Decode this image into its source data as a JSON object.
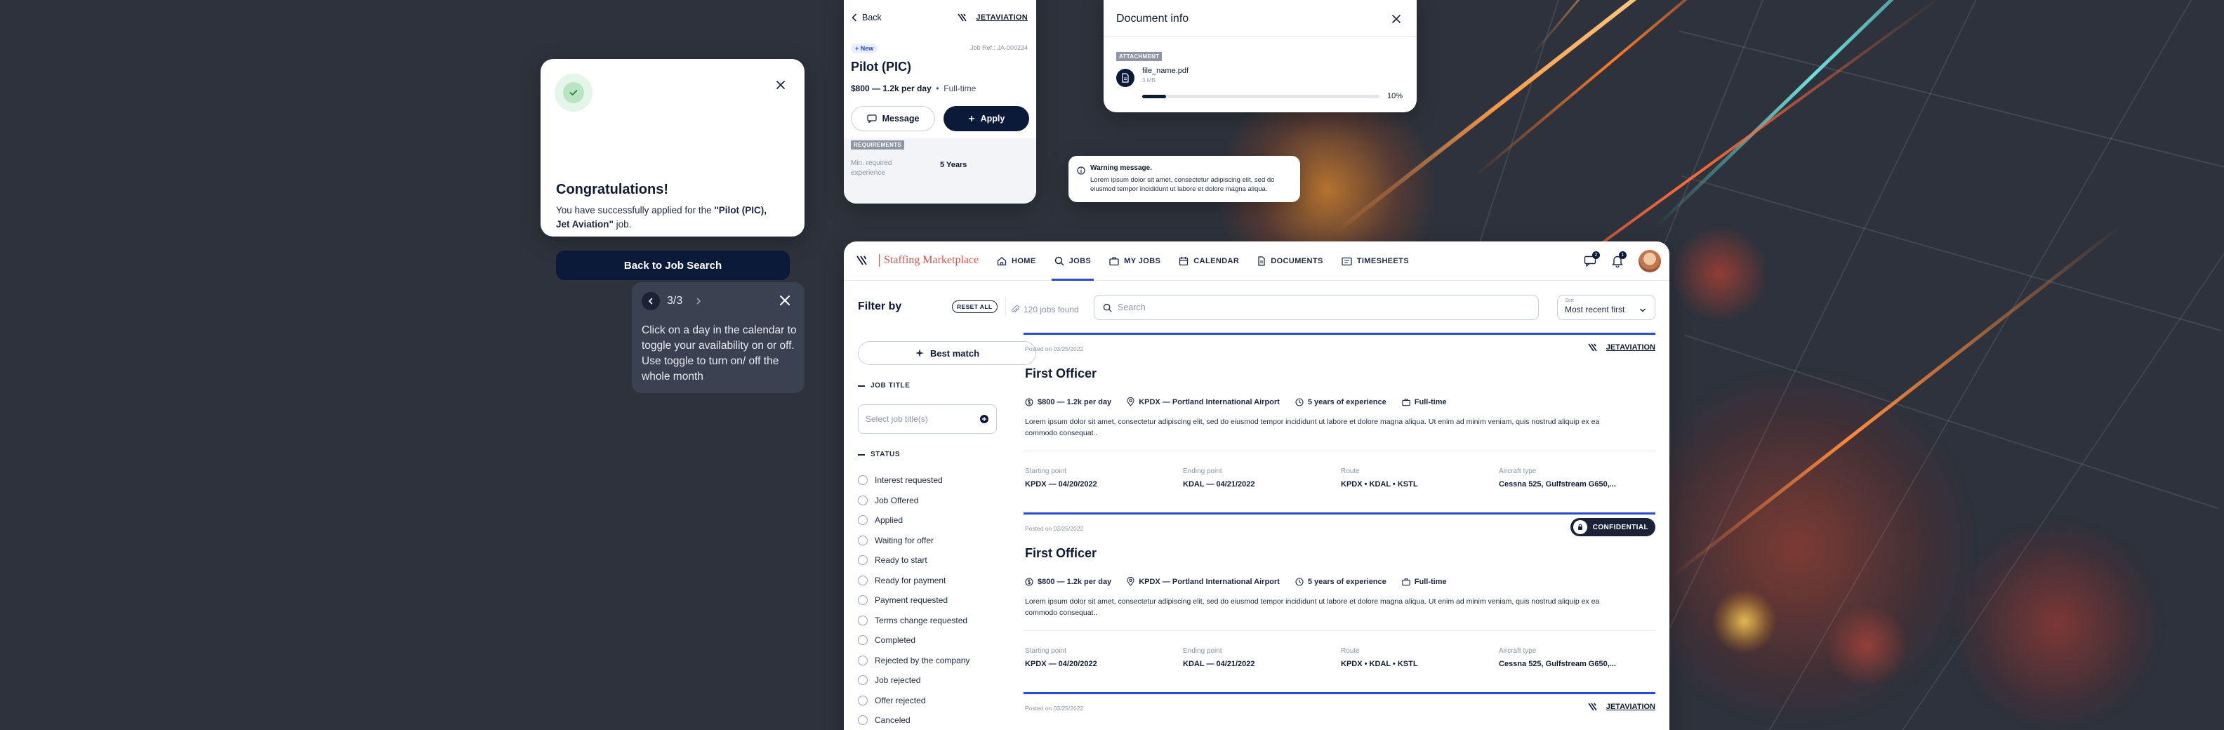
{
  "congrats": {
    "title": "Congratulations!",
    "message_prefix": "You have successfully applied for the ",
    "job_strong": "\"Pilot (PIC), Jet Aviation\"",
    "message_suffix": " job.",
    "button": "Back to Job Search"
  },
  "tooltip": {
    "counter": "3/3",
    "text": "Click on a day in the calendar to toggle your availability on or off. Use toggle to turn on/ off the whole month"
  },
  "mobile": {
    "back": "Back",
    "logo": "JETAVIATION",
    "badge": "+ New",
    "ref": "Job Ref.: JA-000234",
    "title": "Pilot (PIC)",
    "rate": "$800 — 1.2k per day",
    "type": "Full-time",
    "btn_message": "Message",
    "btn_apply": "Apply",
    "req_badge": "REQUIREMENTS",
    "req_label": "Min. required experience",
    "req_value": "5 Years"
  },
  "docinfo": {
    "title": "Document info",
    "badge": "ATTACHMENT",
    "file_name": "file_name.pdf",
    "file_size": "3 MB",
    "progress_pct": 10,
    "progress_text": "10%"
  },
  "warning": {
    "title": "Warning message.",
    "text": "Lorem ipsum dolor sit amet, consectetur adipiscing elit, sed do eiusmod tempor incididunt ut labore et dolore magna aliqua."
  },
  "app": {
    "brand": "Staffing Marketplace",
    "nav": [
      "HOME",
      "JOBS",
      "MY JOBS",
      "CALENDAR",
      "DOCUMENTS",
      "TIMESHEETS"
    ],
    "msg_count": "2",
    "notif_count": "1",
    "filter_title": "Filter by",
    "reset": "RESET ALL",
    "found": "120  jobs found",
    "search_placeholder": "Search",
    "sort_label": "Sort",
    "sort_value": "Most recent first",
    "best_match": "Best match",
    "job_title_label": "JOB TITLE",
    "job_title_placeholder": "Select job title(s)",
    "status_label": "STATUS",
    "statuses": [
      "Interest requested",
      "Job Offered",
      "Applied",
      "Waiting for offer",
      "Ready to start",
      "Ready for payment",
      "Payment requested",
      "Terms change requested",
      "Completed",
      "Rejected by the company",
      "Job rejected",
      "Offer rejected",
      "Canceled"
    ]
  },
  "jobs": [
    {
      "posted": "Posted on 03/25/2022",
      "company": "JETAVIATION",
      "title": "First Officer",
      "rate": "$800 — 1.2k per day",
      "airport": "KPDX — Portland International Airport",
      "experience": "5 years of experience",
      "type": "Full-time",
      "description": "Lorem ipsum dolor sit amet, consectetur adipiscing elit, sed do eiusmod tempor incididunt ut labore et dolore magna aliqua. Ut enim ad minim veniam, quis nostrud aliquip ex ea commodo consequat..",
      "start_label": "Starting point",
      "start": "KPDX — 04/20/2022",
      "end_label": "Ending point",
      "end": "KDAL — 04/21/2022",
      "route_label": "Route",
      "route": "KPDX  •  KDAL  •  KSTL",
      "aircraft_label": "Aircraft type",
      "aircraft": "Cessna 525, Gulfstream G650,..."
    },
    {
      "posted": "Posted on 03/25/2022",
      "confidential": "CONFIDENTIAL",
      "title": "First Officer",
      "rate": "$800 — 1.2k per day",
      "airport": "KPDX — Portland International Airport",
      "experience": "5 years of experience",
      "type": "Full-time",
      "description": "Lorem ipsum dolor sit amet, consectetur adipiscing elit, sed do eiusmod tempor incididunt ut labore et dolore magna aliqua. Ut enim ad minim veniam, quis nostrud aliquip ex ea commodo consequat..",
      "start_label": "Starting point",
      "start": "KPDX — 04/20/2022",
      "end_label": "Ending point",
      "end": "KDAL — 04/21/2022",
      "route_label": "Route",
      "route": "KPDX  •  KDAL  •  KSTL",
      "aircraft_label": "Aircraft type",
      "aircraft": "Cessna 525, Gulfstream G650,..."
    },
    {
      "posted": "Posted on 03/25/2022",
      "company": "JETAVIATION"
    }
  ]
}
